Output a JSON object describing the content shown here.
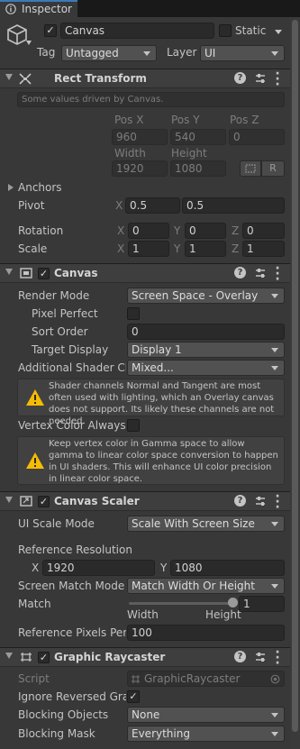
{
  "tab": {
    "label": "Inspector"
  },
  "object": {
    "name": "Canvas",
    "static_label": "Static",
    "tag_label": "Tag",
    "tag_value": "Untagged",
    "layer_label": "Layer",
    "layer_value": "UI"
  },
  "rect_transform": {
    "title": "Rect Transform",
    "notice": "Some values driven by Canvas.",
    "pos_x_label": "Pos X",
    "pos_y_label": "Pos Y",
    "pos_z_label": "Pos Z",
    "pos_x": "960",
    "pos_y": "540",
    "pos_z": "0",
    "width_label": "Width",
    "height_label": "Height",
    "width": "1920",
    "height": "1080",
    "r_button": "R",
    "anchors_label": "Anchors",
    "pivot_label": "Pivot",
    "pivot_x_label": "X",
    "pivot_x": "0.5",
    "pivot_y_label": "Y",
    "pivot_y": "0.5",
    "rotation_label": "Rotation",
    "rot_x": "0",
    "rot_y": "0",
    "rot_z": "0",
    "scale_label": "Scale",
    "scale_x": "1",
    "scale_y": "1",
    "scale_z": "1",
    "x_label": "X",
    "y_label": "Y",
    "z_label": "Z"
  },
  "canvas": {
    "title": "Canvas",
    "render_mode_label": "Render Mode",
    "render_mode": "Screen Space - Overlay",
    "pixel_perfect_label": "Pixel Perfect",
    "sort_order_label": "Sort Order",
    "sort_order": "0",
    "target_display_label": "Target Display",
    "target_display": "Display 1",
    "shader_label": "Additional Shader Ch",
    "shader_value": "Mixed...",
    "warning1": "Shader channels Normal and Tangent are most often used with lighting, which an Overlay canvas does not support. Its likely these channels are not needed.",
    "vertex_color_label": "Vertex Color Always I",
    "warning2": "Keep vertex color in Gamma space to allow gamma to linear color space conversion to happen in UI shaders. This will enhance UI color precision in linear color space."
  },
  "canvas_scaler": {
    "title": "Canvas Scaler",
    "ui_scale_mode_label": "UI Scale Mode",
    "ui_scale_mode": "Scale With Screen Size",
    "ref_res_label": "Reference Resolution",
    "ref_x_label": "X",
    "ref_x": "1920",
    "ref_y_label": "Y",
    "ref_y": "1080",
    "match_mode_label": "Screen Match Mode",
    "match_mode": "Match Width Or Height",
    "match_label": "Match",
    "match_value": "1",
    "match_fraction": 1.0,
    "match_left": "Width",
    "match_right": "Height",
    "ref_pixels_label": "Reference Pixels Per",
    "ref_pixels": "100"
  },
  "graphic_raycaster": {
    "title": "Graphic Raycaster",
    "script_label": "Script",
    "script_value": "GraphicRaycaster",
    "ignore_reversed_label": "Ignore Reversed Gra",
    "blocking_objects_label": "Blocking Objects",
    "blocking_objects": "None",
    "blocking_mask_label": "Blocking Mask",
    "blocking_mask": "Everything"
  },
  "colors": {
    "accent": "#3a79bb",
    "background": "#383838",
    "header": "#3e3e3e"
  }
}
